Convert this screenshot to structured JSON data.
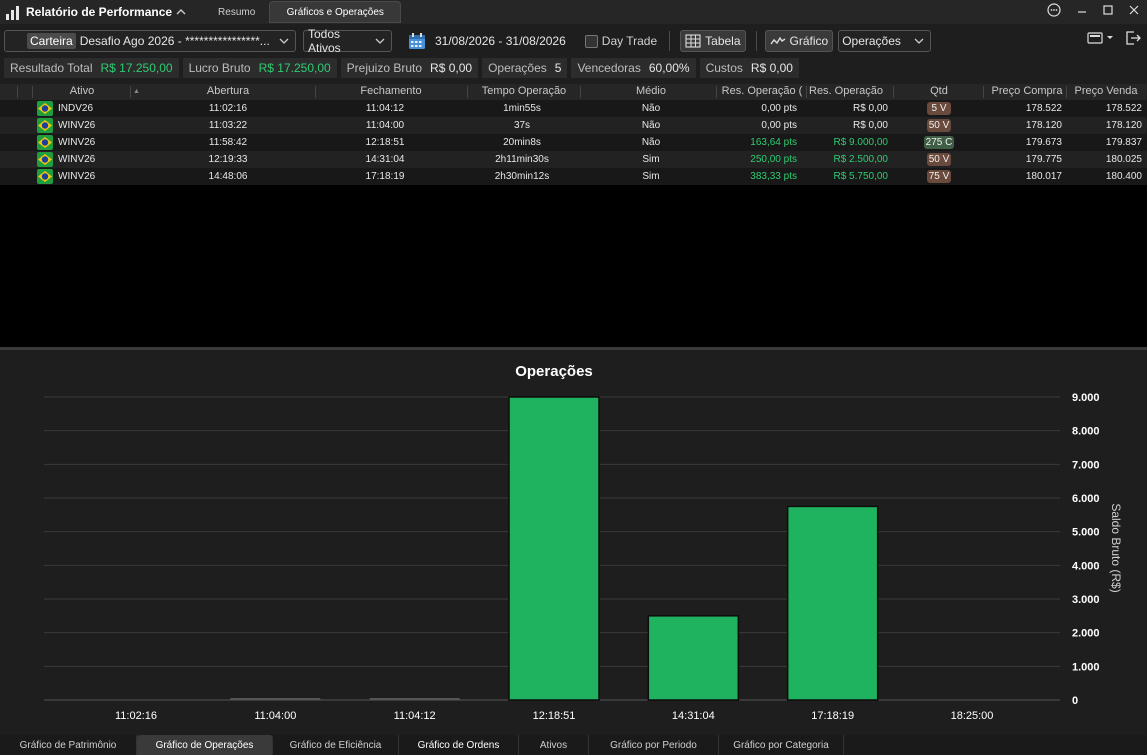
{
  "window": {
    "title": "Relatório de Performance",
    "tabs": [
      {
        "label": "Resumo",
        "active": false
      },
      {
        "label": "Gráficos e Operações",
        "active": true
      }
    ]
  },
  "toolbar": {
    "carteira_label": "Carteira",
    "carteira_value": "Desafio Ago 2026 - ****************...",
    "ativos_value": "Todos Ativos",
    "date_range": "31/08/2026 - 31/08/2026",
    "day_trade_label": "Day Trade",
    "day_trade_checked": false,
    "tabela_label": "Tabela",
    "grafico_label": "Gráfico",
    "chart_type_value": "Operações"
  },
  "summary": [
    {
      "label": "Resultado Total",
      "value": "R$ 17.250,00",
      "positive": true
    },
    {
      "label": "Lucro Bruto",
      "value": "R$ 17.250,00",
      "positive": true
    },
    {
      "label": "Prejuizo Bruto",
      "value": "R$ 0,00",
      "positive": false
    },
    {
      "label": "Operações",
      "value": "5",
      "positive": false
    },
    {
      "label": "Vencedoras",
      "value": "60,00%",
      "positive": false
    },
    {
      "label": "Custos",
      "value": "R$ 0,00",
      "positive": false
    }
  ],
  "table": {
    "columns": [
      "Ativo",
      "Abertura",
      "Fechamento",
      "Tempo Operação",
      "Médio",
      "Res. Operação (",
      "Res. Operação",
      "Qtd",
      "Preço Compra",
      "Preço Venda"
    ],
    "rows": [
      {
        "ativo": "INDV26",
        "abertura": "11:02:16",
        "fechamento": "11:04:12",
        "tempo": "1min55s",
        "medio": "Não",
        "res_pts": "0,00 pts",
        "res_rs": "R$ 0,00",
        "qtd": "5 V",
        "qtd_side": "V",
        "compra": "178.522",
        "venda": "178.522",
        "positive": false
      },
      {
        "ativo": "WINV26",
        "abertura": "11:03:22",
        "fechamento": "11:04:00",
        "tempo": "37s",
        "medio": "Não",
        "res_pts": "0,00 pts",
        "res_rs": "R$ 0,00",
        "qtd": "50 V",
        "qtd_side": "V",
        "compra": "178.120",
        "venda": "178.120",
        "positive": false
      },
      {
        "ativo": "WINV26",
        "abertura": "11:58:42",
        "fechamento": "12:18:51",
        "tempo": "20min8s",
        "medio": "Não",
        "res_pts": "163,64 pts",
        "res_rs": "R$ 9.000,00",
        "qtd": "275 C",
        "qtd_side": "C",
        "compra": "179.673",
        "venda": "179.837",
        "positive": true
      },
      {
        "ativo": "WINV26",
        "abertura": "12:19:33",
        "fechamento": "14:31:04",
        "tempo": "2h11min30s",
        "medio": "Sim",
        "res_pts": "250,00 pts",
        "res_rs": "R$ 2.500,00",
        "qtd": "50 V",
        "qtd_side": "V",
        "compra": "179.775",
        "venda": "180.025",
        "positive": true
      },
      {
        "ativo": "WINV26",
        "abertura": "14:48:06",
        "fechamento": "17:18:19",
        "tempo": "2h30min12s",
        "medio": "Sim",
        "res_pts": "383,33 pts",
        "res_rs": "R$ 5.750,00",
        "qtd": "75 V",
        "qtd_side": "V",
        "compra": "180.017",
        "venda": "180.400",
        "positive": true
      }
    ]
  },
  "chart_data": {
    "type": "bar",
    "title": "Operações",
    "ylabel": "Saldo Bruto (R$)",
    "xlabel": "",
    "categories": [
      "11:02:16",
      "11:04:00",
      "11:04:12",
      "12:18:51",
      "14:31:04",
      "17:18:19",
      "18:25:00"
    ],
    "bars": [
      {
        "category": "11:04:00",
        "value": 0
      },
      {
        "category": "11:04:12",
        "value": 0
      },
      {
        "category": "12:18:51",
        "value": 9000
      },
      {
        "category": "14:31:04",
        "value": 2500
      },
      {
        "category": "17:18:19",
        "value": 5750
      }
    ],
    "ylim": [
      0,
      9000
    ],
    "yticks": [
      0,
      1000,
      2000,
      3000,
      4000,
      5000,
      6000,
      7000,
      8000,
      9000
    ],
    "ytick_labels": [
      "0",
      "1.000",
      "2.000",
      "3.000",
      "4.000",
      "5.000",
      "6.000",
      "7.000",
      "8.000",
      "9.000"
    ],
    "grid": true,
    "bar_color": "#1fb35f"
  },
  "bottom_tabs": [
    {
      "label": "Gráfico de Patrimônio",
      "active": false,
      "bold": false
    },
    {
      "label": "Gráfico de Operações",
      "active": true,
      "bold": false
    },
    {
      "label": "Gráfico de Eficiência",
      "active": false,
      "bold": false
    },
    {
      "label": "Gráfico de Ordens",
      "active": false,
      "bold": true
    },
    {
      "label": "Ativos",
      "active": false,
      "bold": false
    },
    {
      "label": "Gráfico por Periodo",
      "active": false,
      "bold": false
    },
    {
      "label": "Gráfico por Categoria",
      "active": false,
      "bold": false
    }
  ],
  "colors": {
    "positive": "#2ecc71",
    "accent_bar": "#1fb35f",
    "background": "#1e1e1e"
  }
}
